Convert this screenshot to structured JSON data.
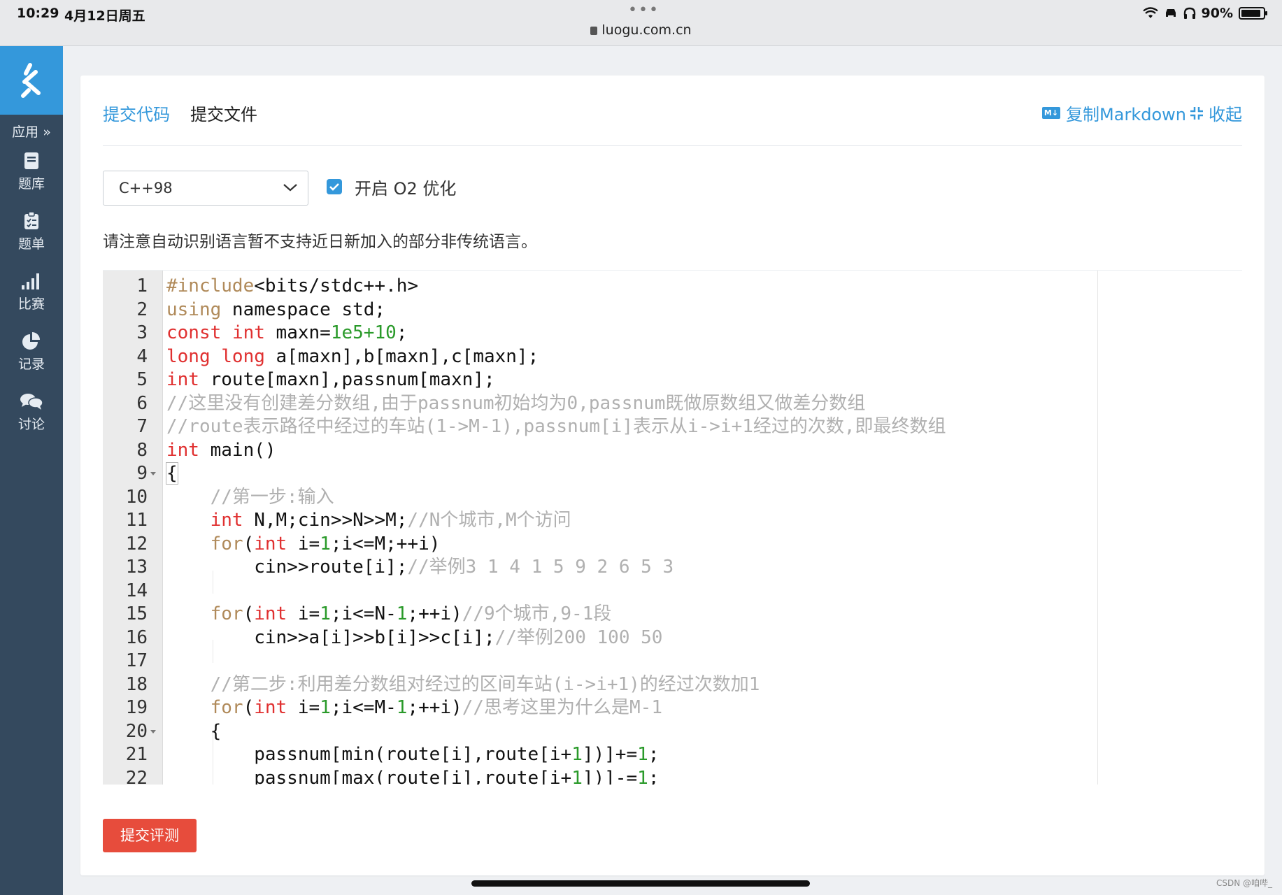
{
  "status_bar": {
    "time": "10:29",
    "date": "4月12日周五",
    "dots": "•••",
    "url": "luogu.com.cn",
    "battery": "90%",
    "battery_level": 0.9
  },
  "sidebar": {
    "apps_label": "应用 »",
    "items": [
      {
        "label": "题库",
        "icon": "book-icon"
      },
      {
        "label": "题单",
        "icon": "clipboard-icon"
      },
      {
        "label": "比赛",
        "icon": "bar-chart-icon"
      },
      {
        "label": "记录",
        "icon": "pie-chart-icon"
      },
      {
        "label": "讨论",
        "icon": "chat-icon"
      }
    ]
  },
  "card": {
    "tabs": [
      {
        "label": "提交代码",
        "active": true
      },
      {
        "label": "提交文件",
        "active": false
      }
    ],
    "copy_markdown": {
      "badge": "M↓",
      "label": "复制Markdown"
    },
    "collapse_label": "收起",
    "language_select": {
      "value": "C++98"
    },
    "o2_checkbox": {
      "label": "开启 O2 优化",
      "checked": true
    },
    "notice": "请注意自动识别语言暂不支持近日新加入的部分非传统语言。",
    "submit_label": "提交评测"
  },
  "editor": {
    "line_numbers": [
      "1",
      "2",
      "3",
      "4",
      "5",
      "6",
      "7",
      "8",
      "9",
      "10",
      "11",
      "12",
      "13",
      "14",
      "15",
      "16",
      "17",
      "18",
      "19",
      "20",
      "21",
      "22"
    ],
    "fold_lines": [
      9,
      20
    ]
  },
  "watermark": "CSDN @咱哔_",
  "colors": {
    "accent": "#3498db",
    "sidebar": "#34495e",
    "submit": "#e74c3c",
    "keyword": "#e03030",
    "number": "#2a9a2a",
    "comment": "#b0b0b0"
  }
}
